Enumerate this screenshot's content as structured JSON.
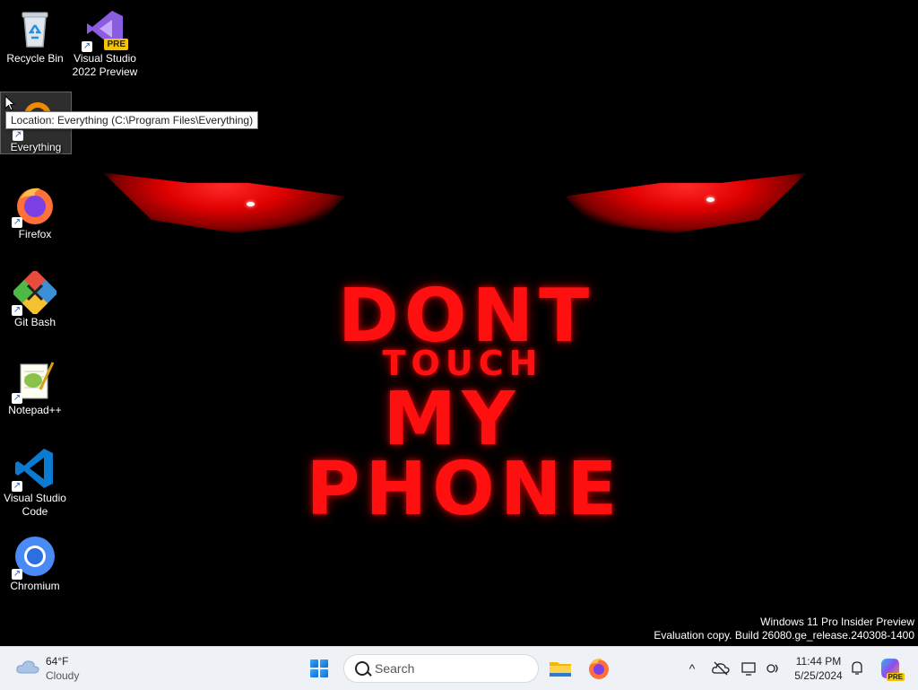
{
  "wallpaper": {
    "line1": "DONT",
    "line2": "TOUCH",
    "line3": "MY",
    "line4": "PHONE",
    "accent_color": "#ff1010"
  },
  "desktop_icons": [
    {
      "label": "Recycle Bin",
      "icon": "recycle-bin-icon"
    },
    {
      "label": "Visual Studio 2022 Preview",
      "badge": "PRE",
      "icon": "visual-studio-icon"
    },
    {
      "label": "Everything",
      "icon": "everything-icon",
      "selected": true
    },
    {
      "label": "Firefox",
      "icon": "firefox-icon"
    },
    {
      "label": "Git Bash",
      "icon": "git-bash-icon"
    },
    {
      "label": "Notepad++",
      "icon": "notepad-plus-plus-icon"
    },
    {
      "label": "Visual Studio Code",
      "icon": "vscode-icon"
    },
    {
      "label": "Chromium",
      "icon": "chromium-icon"
    }
  ],
  "tooltip": "Location: Everything (C:\\Program Files\\Everything)",
  "watermark": {
    "line1": "Windows 11 Pro Insider Preview",
    "line2": "Evaluation copy. Build 26080.ge_release.240308-1400"
  },
  "taskbar": {
    "weather": {
      "temp": "64°F",
      "condition": "Cloudy"
    },
    "search_placeholder": "Search",
    "clock": {
      "time": "11:44 PM",
      "date": "5/25/2024"
    },
    "copilot_badge": "PRE"
  }
}
